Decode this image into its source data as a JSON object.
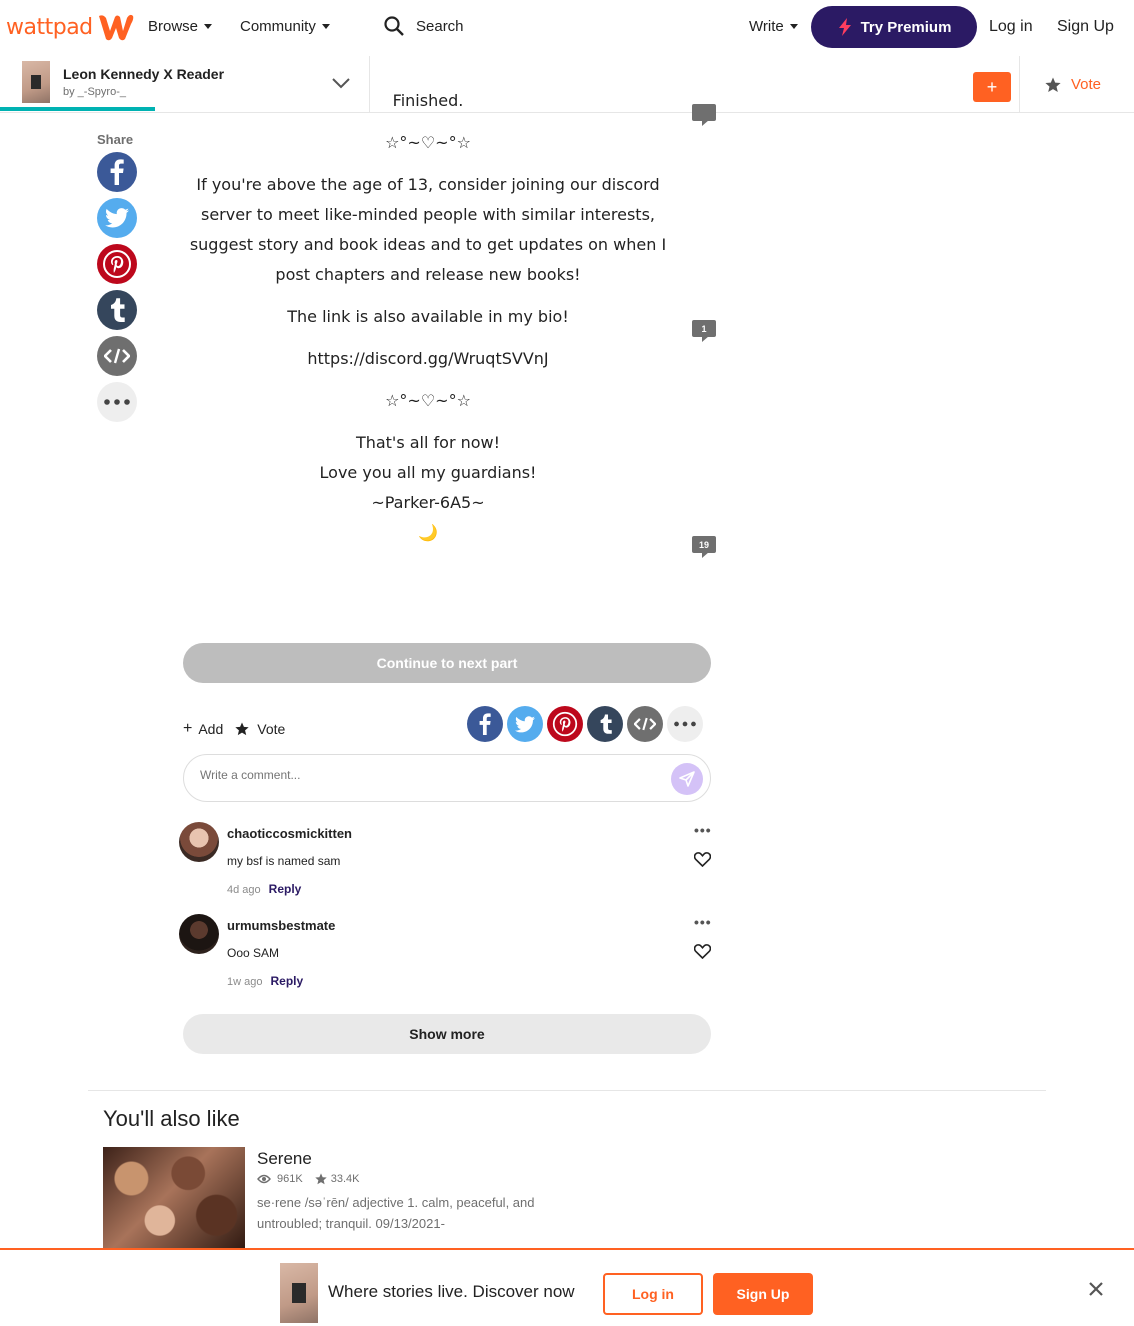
{
  "nav": {
    "logo": "wattpad",
    "browse": "Browse",
    "community": "Community",
    "search": "Search",
    "write": "Write",
    "premium": "Try Premium",
    "login": "Log in",
    "signup": "Sign Up"
  },
  "storybar": {
    "title": "Leon Kennedy X Reader",
    "author": "by _-Spyro-_",
    "add": "+",
    "vote": "Vote"
  },
  "share": {
    "label": "Share",
    "icons": [
      "facebook-icon",
      "twitter-icon",
      "pinterest-icon",
      "tumblr-icon",
      "embed-icon",
      "more-icon"
    ]
  },
  "story": {
    "cut_line": "Finished.",
    "divider1": "☆°~♡~°☆",
    "para1": "If you're above the age of 13, consider joining our discord server to meet like-minded people with similar interests, suggest story and book ideas and to get updates on when I post chapters and release new books!",
    "para2": "The link is also available in my bio!",
    "link": "https://discord.gg/WruqtSVVnJ",
    "divider2": "☆°~♡~°☆",
    "line1": "That's all for now!",
    "line2": "Love you all my guardians!",
    "line3": "~Parker-6A5~",
    "emoji": "🌙",
    "comment_count_1": "1",
    "comment_count_2": "19"
  },
  "continue": "Continue to next part",
  "actions": {
    "add": "Add",
    "vote": "Vote"
  },
  "comment_box": {
    "placeholder": "Write a comment..."
  },
  "comments": [
    {
      "user": "chaoticcosmickitten",
      "text": "my bsf is named sam",
      "time": "4d ago",
      "reply": "Reply"
    },
    {
      "user": "urmumsbestmate",
      "text": "Ooo SAM",
      "time": "1w ago",
      "reply": "Reply"
    }
  ],
  "show_more": "Show more",
  "also_like": {
    "heading": "You'll also like",
    "title": "Serene",
    "reads": "961K",
    "votes": "33.4K",
    "desc": "se·rene /səˈrēn/ adjective 1. calm, peaceful, and untroubled; tranquil. 09/13/2021-"
  },
  "banner": {
    "text": "Where stories live. Discover now",
    "login": "Log in",
    "signup": "Sign Up"
  },
  "colors": {
    "brand": "#ff6122",
    "premium": "#2b1a64",
    "facebook": "#3b5998",
    "twitter": "#55acee",
    "pinterest": "#bd081c",
    "tumblr": "#35465c",
    "embed": "#6f6f6f"
  }
}
